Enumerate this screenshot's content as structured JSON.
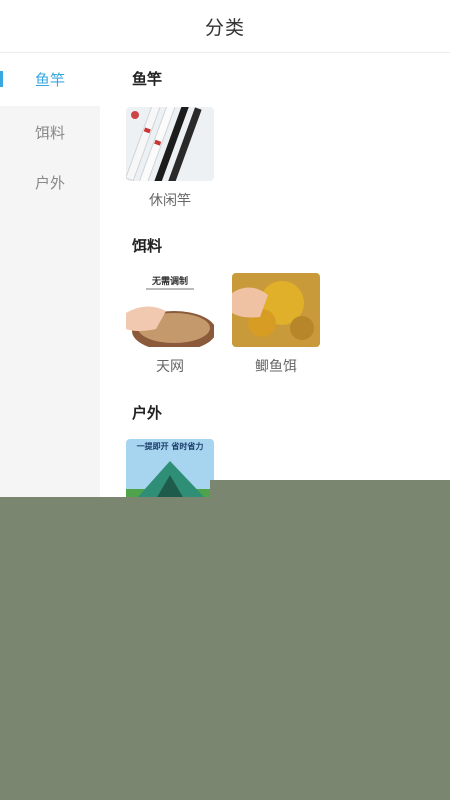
{
  "header": {
    "title": "分类"
  },
  "sidebar": {
    "items": [
      {
        "label": "鱼竿",
        "active": true
      },
      {
        "label": "饵料",
        "active": false
      },
      {
        "label": "户外",
        "active": false
      }
    ]
  },
  "sections": [
    {
      "title": "鱼竿",
      "products": [
        {
          "name": "休闲竿",
          "icon": "fishing-rod-image"
        }
      ]
    },
    {
      "title": "饵料",
      "products": [
        {
          "name": "天网",
          "icon": "bait-powder-image",
          "overlay_text": "无需调制"
        },
        {
          "name": "鲫鱼饵",
          "icon": "yellow-bait-image"
        }
      ]
    },
    {
      "title": "户外",
      "products": [
        {
          "name": "",
          "icon": "tent-image",
          "overlay_text": "一提即开 省时省力"
        }
      ]
    }
  ],
  "colors": {
    "accent": "#3aa7e0",
    "overlay": "#7a8670",
    "sidebar_bg": "#f5f5f5"
  }
}
